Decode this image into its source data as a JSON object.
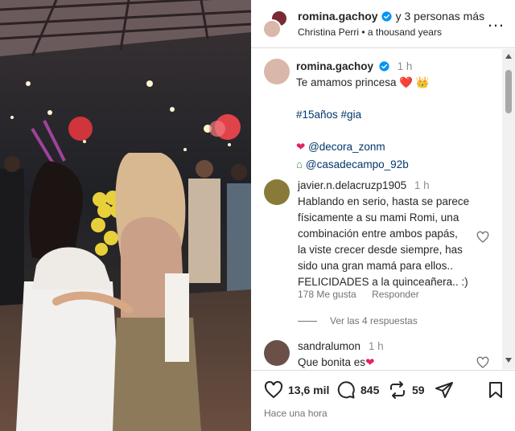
{
  "header": {
    "username": "romina.gachoy",
    "others": "y 3 personas más",
    "audio": "Christina Perri • a thousand years"
  },
  "caption": {
    "username": "romina.gachoy",
    "time": "1 h",
    "text": "Te amamos princesa",
    "emoji_heart": "❤️",
    "emoji_crown": "👑",
    "hashtags": "#15años #gia",
    "mention1": "@decora_zonm",
    "mention2": "@casadecampo_92b"
  },
  "comments": [
    {
      "username": "javier.n.delacruzp1905",
      "time": "1 h",
      "text_lines": [
        "Hablando en serio, hasta se parece",
        "físicamente a su mami Romi, una",
        "combinación entre ambos papás,",
        "la viste crecer desde siempre, has",
        "sido una gran mamá para ellos..",
        "FELICIDADES a la quinceañera.. :)"
      ],
      "likes": "178 Me gusta",
      "reply": "Responder",
      "view_replies": "Ver las 4 respuestas"
    },
    {
      "username": "sandralumon",
      "time": "1 h",
      "text": "Que bonita es"
    }
  ],
  "actions": {
    "likes": "13,6 mil",
    "comments": "845",
    "reposts": "59",
    "time_ago": "Hace una hora"
  },
  "colors": {
    "link": "#00376b",
    "muted": "#737373",
    "verified": "#0095f6",
    "heart": "#e0245e"
  }
}
